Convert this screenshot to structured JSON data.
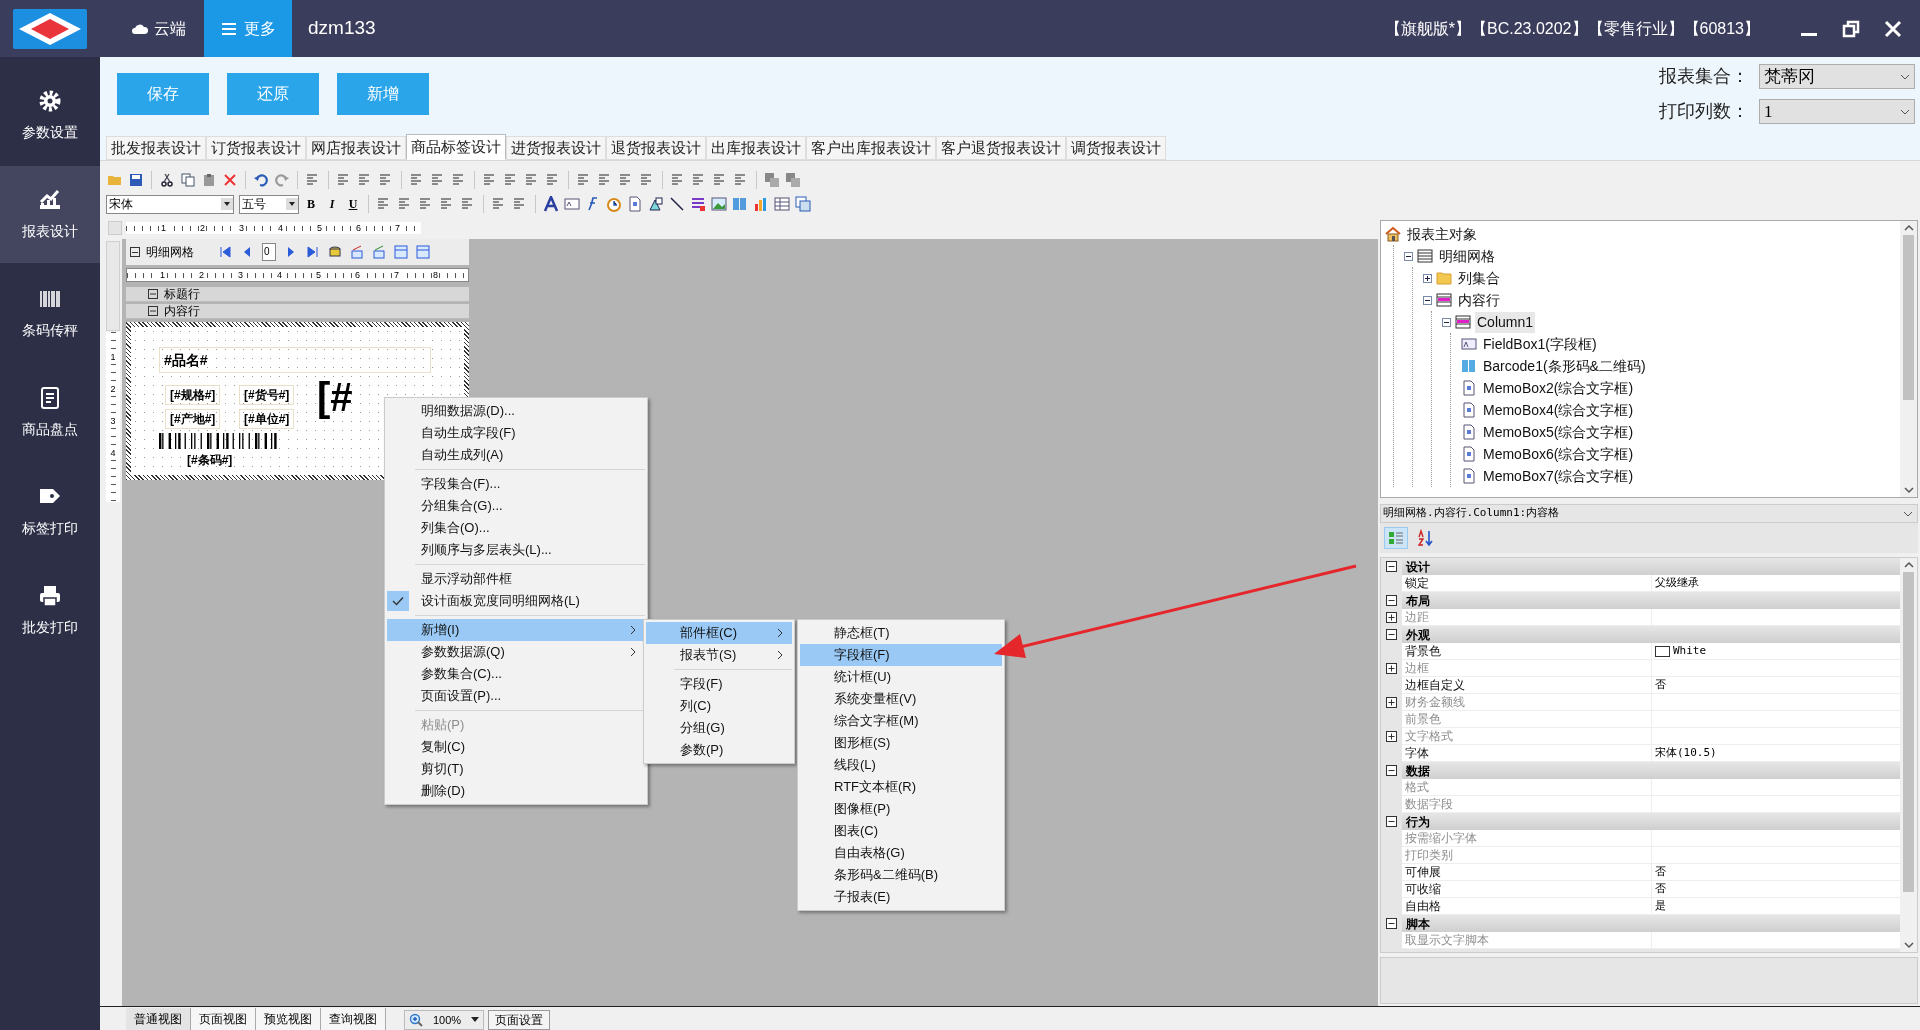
{
  "header": {
    "nav": [
      {
        "label": "云端",
        "kind": "cloud",
        "selected": false
      },
      {
        "label": "更多",
        "kind": "menu",
        "selected": true
      }
    ],
    "user": "dzm133",
    "info": "【旗舰版*】【BC.23.0202】【零售行业】【60813】"
  },
  "sidebar": {
    "items": [
      {
        "label": "参数设置",
        "kind": "gear",
        "selected": false
      },
      {
        "label": "报表设计",
        "kind": "chart",
        "selected": true
      },
      {
        "label": "条码传秤",
        "kind": "barcode",
        "selected": false
      },
      {
        "label": "商品盘点",
        "kind": "clipboard",
        "selected": false
      },
      {
        "label": "标签打印",
        "kind": "tag",
        "selected": false
      },
      {
        "label": "批发打印",
        "kind": "printer",
        "selected": false
      }
    ]
  },
  "actions": [
    "保存",
    "还原",
    "新增"
  ],
  "settings": [
    {
      "label": "报表集合：",
      "value": "梵蒂冈"
    },
    {
      "label": "打印列数：",
      "value": "1"
    }
  ],
  "tabs": [
    {
      "label": "批发报表设计",
      "selected": false
    },
    {
      "label": "订货报表设计",
      "selected": false
    },
    {
      "label": "网店报表设计",
      "selected": false
    },
    {
      "label": "商品标签设计",
      "selected": true
    },
    {
      "label": "进货报表设计",
      "selected": false
    },
    {
      "label": "退货报表设计",
      "selected": false
    },
    {
      "label": "出库报表设计",
      "selected": false
    },
    {
      "label": "客户出库报表设计",
      "selected": false
    },
    {
      "label": "客户退货报表设计",
      "selected": false
    },
    {
      "label": "调货报表设计",
      "selected": false
    }
  ],
  "format_toolbar": {
    "font": "宋体",
    "size": "五号",
    "styles": [
      "B",
      "I",
      "U"
    ]
  },
  "designer": {
    "top_ruler": [
      "1",
      "2",
      "3",
      "4",
      "5",
      "6",
      "7"
    ],
    "grid_title": "明细网格",
    "page": "0",
    "grid_ruler": [
      "1",
      "2",
      "3",
      "4",
      "5",
      "6",
      "7",
      "8"
    ],
    "bands": [
      "标题行",
      "内容行"
    ],
    "side_ruler": [
      "1",
      "2",
      "3",
      "4"
    ],
    "fields": [
      {
        "text": "#品名#",
        "kind": "title"
      },
      {
        "text": "[#规格#]",
        "kind": "small"
      },
      {
        "text": "[#货号#]",
        "kind": "small"
      },
      {
        "text": "[#产地#]",
        "kind": "small"
      },
      {
        "text": "[#单位#]",
        "kind": "small"
      },
      {
        "text": "[#",
        "kind": "large"
      },
      {
        "text": "[#条码#]",
        "kind": "barcode"
      }
    ]
  },
  "context_menu": [
    {
      "kind": "item",
      "label": "明细数据源(D)...",
      "checked": false,
      "disabled": false,
      "submenu": false,
      "highlighted": false
    },
    {
      "kind": "item",
      "label": "自动生成字段(F)",
      "checked": false,
      "disabled": false,
      "submenu": false,
      "highlighted": false
    },
    {
      "kind": "item",
      "label": "自动生成列(A)",
      "checked": false,
      "disabled": false,
      "submenu": false,
      "highlighted": false
    },
    {
      "kind": "separator"
    },
    {
      "kind": "item",
      "label": "字段集合(F)...",
      "checked": false,
      "disabled": false,
      "submenu": false,
      "highlighted": false
    },
    {
      "kind": "item",
      "label": "分组集合(G)...",
      "checked": false,
      "disabled": false,
      "submenu": false,
      "highlighted": false
    },
    {
      "kind": "item",
      "label": "列集合(O)...",
      "checked": false,
      "disabled": false,
      "submenu": false,
      "highlighted": false
    },
    {
      "kind": "item",
      "label": "列顺序与多层表头(L)...",
      "checked": false,
      "disabled": false,
      "submenu": false,
      "highlighted": false
    },
    {
      "kind": "separator"
    },
    {
      "kind": "item",
      "label": "显示浮动部件框",
      "checked": false,
      "disabled": false,
      "submenu": false,
      "highlighted": false
    },
    {
      "kind": "item",
      "label": "设计面板宽度同明细网格(L)",
      "checked": true,
      "disabled": false,
      "submenu": false,
      "highlighted": false
    },
    {
      "kind": "separator"
    },
    {
      "kind": "item",
      "label": "新增(I)",
      "checked": false,
      "disabled": false,
      "submenu": true,
      "highlighted": true
    },
    {
      "kind": "item",
      "label": "参数数据源(Q)",
      "checked": false,
      "disabled": false,
      "submenu": true,
      "highlighted": false
    },
    {
      "kind": "item",
      "label": "参数集合(C)...",
      "checked": false,
      "disabled": false,
      "submenu": false,
      "highlighted": false
    },
    {
      "kind": "item",
      "label": "页面设置(P)...",
      "checked": false,
      "disabled": false,
      "submenu": false,
      "highlighted": false
    },
    {
      "kind": "separator"
    },
    {
      "kind": "item",
      "label": "粘贴(P)",
      "checked": false,
      "disabled": true,
      "submenu": false,
      "highlighted": false
    },
    {
      "kind": "item",
      "label": "复制(C)",
      "checked": false,
      "disabled": false,
      "submenu": false,
      "highlighted": false
    },
    {
      "kind": "item",
      "label": "剪切(T)",
      "checked": false,
      "disabled": false,
      "submenu": false,
      "highlighted": false
    },
    {
      "kind": "item",
      "label": "删除(D)",
      "checked": false,
      "disabled": false,
      "submenu": false,
      "highlighted": false
    }
  ],
  "submenu": [
    {
      "kind": "item",
      "label": "部件框(C)",
      "submenu": true,
      "highlighted": true
    },
    {
      "kind": "item",
      "label": "报表节(S)",
      "submenu": true,
      "highlighted": false
    },
    {
      "kind": "separator"
    },
    {
      "kind": "item",
      "label": "字段(F)",
      "submenu": false,
      "highlighted": false
    },
    {
      "kind": "item",
      "label": "列(C)",
      "submenu": false,
      "highlighted": false
    },
    {
      "kind": "item",
      "label": "分组(G)",
      "submenu": false,
      "highlighted": false
    },
    {
      "kind": "item",
      "label": "参数(P)",
      "submenu": false,
      "highlighted": false
    }
  ],
  "sub_submenu": [
    {
      "label": "静态框(T)",
      "highlighted": false
    },
    {
      "label": "字段框(F)",
      "highlighted": true
    },
    {
      "label": "统计框(U)",
      "highlighted": false
    },
    {
      "label": "系统变量框(V)",
      "highlighted": false
    },
    {
      "label": "综合文字框(M)",
      "highlighted": false
    },
    {
      "label": "图形框(S)",
      "highlighted": false
    },
    {
      "label": "线段(L)",
      "highlighted": false
    },
    {
      "label": "RTF文本框(R)",
      "highlighted": false
    },
    {
      "label": "图像框(P)",
      "highlighted": false
    },
    {
      "label": "图表(C)",
      "highlighted": false
    },
    {
      "label": "自由表格(G)",
      "highlighted": false
    },
    {
      "label": "条形码&二维码(B)",
      "highlighted": false
    },
    {
      "label": "子报表(E)",
      "highlighted": false
    }
  ],
  "tree": [
    {
      "label": "报表主对象",
      "kind": "home",
      "selected": false,
      "children": [
        {
          "label": "明细网格",
          "kind": "grid",
          "selected": false,
          "expanded": true,
          "children": [
            {
              "label": "列集合",
              "kind": "folder",
              "selected": false,
              "expanded": false
            },
            {
              "label": "内容行",
              "kind": "row",
              "selected": false,
              "expanded": true,
              "children": [
                {
                  "label": "Column1",
                  "kind": "row",
                  "selected": true,
                  "expanded": true,
                  "children": [
                    {
                      "label": "FieldBox1(字段框)",
                      "kind": "field",
                      "selected": false
                    },
                    {
                      "label": "Barcode1(条形码&二维码)",
                      "kind": "barcode",
                      "selected": false
                    },
                    {
                      "label": "MemoBox2(综合文字框)",
                      "kind": "memo",
                      "selected": false
                    },
                    {
                      "label": "MemoBox4(综合文字框)",
                      "kind": "memo",
                      "selected": false
                    },
                    {
                      "label": "MemoBox5(综合文字框)",
                      "kind": "memo",
                      "selected": false
                    },
                    {
                      "label": "MemoBox6(综合文字框)",
                      "kind": "memo",
                      "selected": false
                    },
                    {
                      "label": "MemoBox7(综合文字框)",
                      "kind": "memo",
                      "selected": false
                    }
                  ]
                }
              ]
            }
          ]
        }
      ]
    }
  ],
  "properties": {
    "object": "明细网格.内容行.Column1:内容格",
    "categories": [
      {
        "title": "设计",
        "expanded": true,
        "rows": [
          {
            "name": "锁定",
            "value": "父级继承",
            "disabled": false,
            "expandable": false
          }
        ]
      },
      {
        "title": "布局",
        "expanded": true,
        "rows": [
          {
            "name": "边距",
            "disabled": true,
            "expandable": true
          }
        ]
      },
      {
        "title": "外观",
        "expanded": true,
        "rows": [
          {
            "name": "背景色",
            "value": "White",
            "kind": "color",
            "disabled": false,
            "expandable": false
          },
          {
            "name": "边框",
            "disabled": true,
            "expandable": true
          },
          {
            "name": "边框自定义",
            "value": "否",
            "disabled": false,
            "expandable": false
          },
          {
            "name": "财务金额线",
            "disabled": true,
            "expandable": true
          },
          {
            "name": "前景色",
            "disabled": true,
            "expandable": false
          },
          {
            "name": "文字格式",
            "disabled": true,
            "expandable": true
          },
          {
            "name": "字体",
            "value": "宋体(10.5)",
            "disabled": false,
            "expandable": false
          }
        ]
      },
      {
        "title": "数据",
        "expanded": true,
        "rows": [
          {
            "name": "格式",
            "disabled": true,
            "expandable": false
          },
          {
            "name": "数据字段",
            "disabled": true,
            "expandable": false
          }
        ]
      },
      {
        "title": "行为",
        "expanded": true,
        "rows": [
          {
            "name": "按需缩小字体",
            "disabled": true,
            "expandable": false
          },
          {
            "name": "打印类别",
            "disabled": true,
            "expandable": false
          },
          {
            "name": "可伸展",
            "value": "否",
            "disabled": false,
            "expandable": false
          },
          {
            "name": "可收缩",
            "value": "否",
            "disabled": false,
            "expandable": false
          },
          {
            "name": "自由格",
            "value": "是",
            "disabled": false,
            "expandable": false
          }
        ]
      },
      {
        "title": "脚本",
        "expanded": true,
        "rows": [
          {
            "name": "取显示文字脚本",
            "disabled": true,
            "expandable": false
          }
        ]
      }
    ]
  },
  "bottom_bar": {
    "views": [
      {
        "label": "普通视图",
        "selected": true
      },
      {
        "label": "页面视图",
        "selected": false
      },
      {
        "label": "预览视图",
        "selected": false
      },
      {
        "label": "查询视图",
        "selected": false
      }
    ],
    "zoom": "100%",
    "page_setup": "页面设置"
  }
}
